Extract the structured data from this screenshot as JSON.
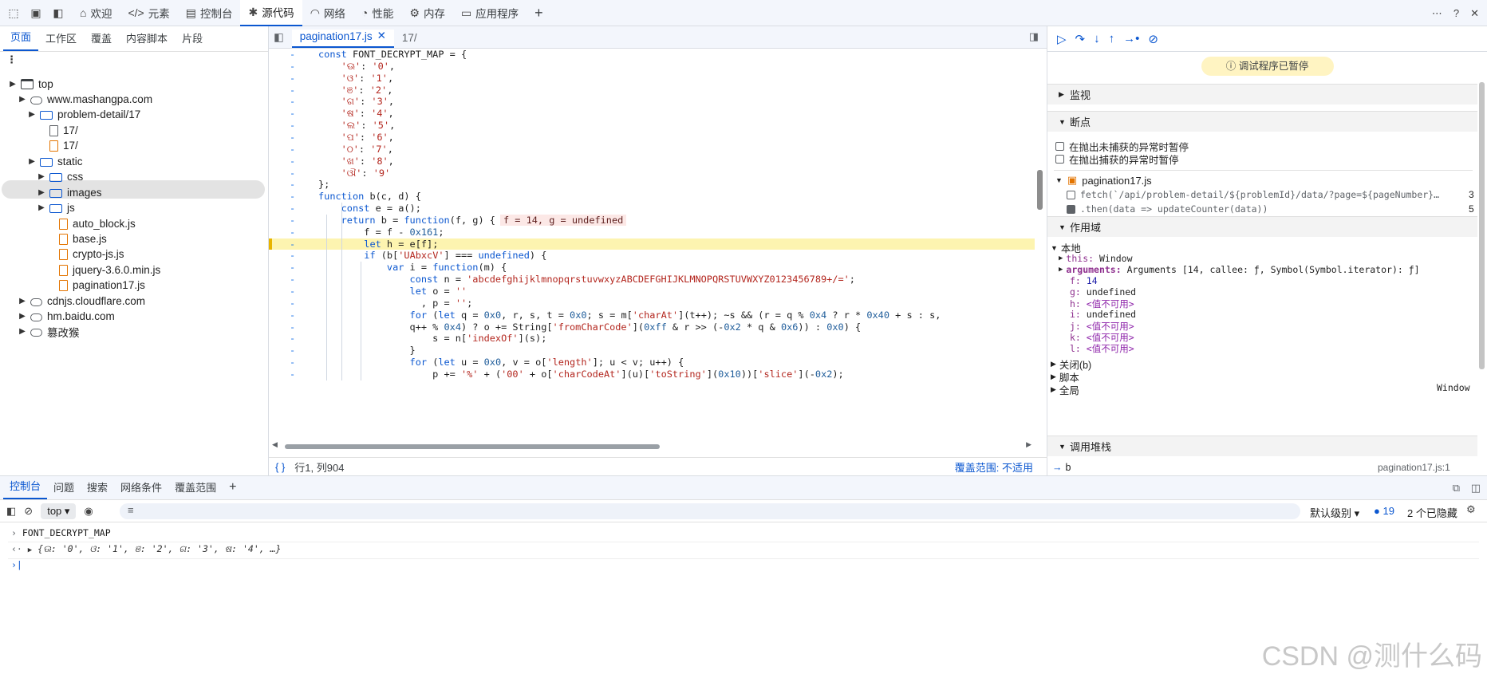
{
  "topbar": {
    "tabs": [
      {
        "label": "欢迎",
        "icon": "home-icon"
      },
      {
        "label": "元素",
        "icon": "code-icon"
      },
      {
        "label": "控制台",
        "icon": "console-icon"
      },
      {
        "label": "源代码",
        "icon": "bug-icon"
      },
      {
        "label": "网络",
        "icon": "wifi-icon"
      },
      {
        "label": "性能",
        "icon": "gauge-icon"
      },
      {
        "label": "内存",
        "icon": "memory-icon"
      },
      {
        "label": "应用程序",
        "icon": "app-icon"
      }
    ],
    "active_tab": "源代码"
  },
  "left": {
    "tabs": [
      "页面",
      "工作区",
      "覆盖",
      "内容脚本",
      "片段"
    ],
    "tree": [
      "top",
      "www.mashangpa.com",
      "problem-detail/17",
      "17/",
      "17/",
      "static",
      "css",
      "images",
      "js",
      "auto_block.js",
      "base.js",
      "crypto-js.js",
      "jquery-3.6.0.min.js",
      "pagination17.js",
      "cdnjs.cloudflare.com",
      "hm.baidu.com",
      "篡改猴"
    ]
  },
  "editor": {
    "tabs": [
      "pagination17.js",
      "17/"
    ],
    "lines": [
      "const FONT_DECRYPT_MAP = {",
      "    'ଊ': '0',",
      "    'ଓ': '1',",
      "    'ଞ': '2',",
      "    'ଗ': '3',",
      "    'ଷ': '4',",
      "    'ଲ': '5',",
      "    'ପ': '6',",
      "    'ଠ': '7',",
      "    'ଖ': '8',",
      "    'ଔ': '9'",
      "};",
      "function b(c, d) {",
      "    const e = a();",
      "    return b = function(f, g) {",
      "        f = f - 0x161;",
      "        let h = e[f];",
      "        if (b['UAbxcV'] === undefined) {",
      "            var i = function(m) {",
      "                const n = 'abcdefghijklmnopqrstuvwxyzABCDEFGHIJKLMNOPQRSTUVWXYZ0123456789+/=';",
      "                let o = ''",
      "                  , p = '';",
      "                for (let q = 0x0, r, s, t = 0x0; s = m['charAt'](t++); ~s && (r = q % 0x4 ? r * 0x40 + s : s,",
      "                q++ % 0x4) ? o += String['fromCharCode'](0xff & r >> (-0x2 * q & 0x6)) : 0x0) {",
      "                    s = n['indexOf'](s);",
      "                }",
      "                for (let u = 0x0, v = o['length']; u < v; u++) {",
      "                    p += '%' + ('00' + o['charCodeAt'](u)['toString'](0x10))['slice'](-0x2);"
    ],
    "inline_value": "f = 14, g = undefined",
    "status": "行1, 列904",
    "coverage": "覆盖范围: 不适用"
  },
  "debugger": {
    "paused_label": "调试程序已暂停",
    "sections": {
      "watch": "监视",
      "breakpoints": "断点",
      "scope": "作用域",
      "callstack": "调用堆栈"
    },
    "pause_uncaught": "在抛出未捕获的异常时暂停",
    "pause_caught": "在抛出捕获的异常时暂停",
    "bp_file": "pagination17.js",
    "bp1_code": "fetch(`/api/problem-detail/${problemId}/data/?page=${pageNumber}…",
    "bp1_line": "3",
    "bp2_code": ".then(data => updateCounter(data))",
    "bp2_line": "5",
    "local": "本地",
    "this_key": "this:",
    "this_val": "Window",
    "args_key": "arguments:",
    "args_val": "Arguments [14, callee: ƒ, Symbol(Symbol.iterator): ƒ]",
    "vars": [
      {
        "k": "f:",
        "v": "14"
      },
      {
        "k": "g:",
        "v": "undefined"
      },
      {
        "k": "h:",
        "v": "<值不可用>"
      },
      {
        "k": "i:",
        "v": "undefined"
      },
      {
        "k": "j:",
        "v": "<值不可用>"
      },
      {
        "k": "k:",
        "v": "<值不可用>"
      },
      {
        "k": "l:",
        "v": "<值不可用>"
      }
    ],
    "closure": "关闭(b)",
    "script": "脚本",
    "global": "全局",
    "global_val": "Window",
    "stack_fn": "b",
    "stack_loc": "pagination17.js:1"
  },
  "drawer": {
    "tabs": [
      "控制台",
      "问题",
      "搜索",
      "网络条件",
      "覆盖范围"
    ],
    "context": "top",
    "level": "默认级别",
    "issues_count": "19",
    "hidden": "2 个已隐藏",
    "log_input": "FONT_DECRYPT_MAP",
    "log_output": "{ଊ: '0', ଓ: '1', ଞ: '2', ଗ: '3', ଷ: '4', …}"
  },
  "watermark": "CSDN @测什么码"
}
